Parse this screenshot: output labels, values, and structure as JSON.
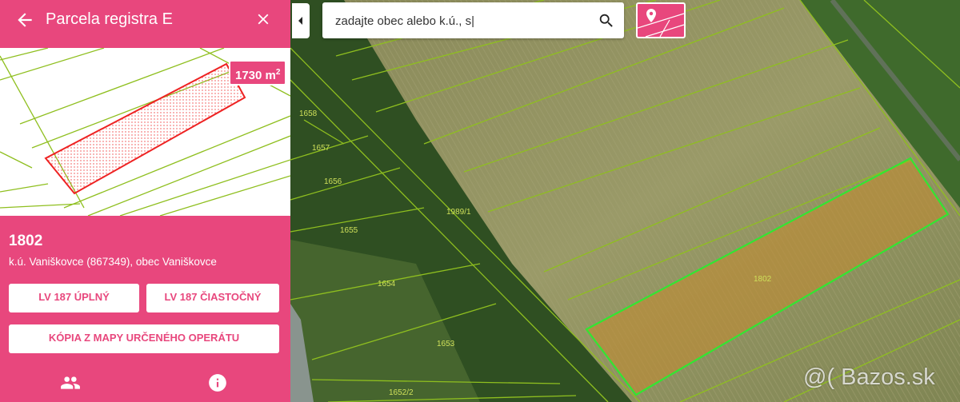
{
  "panel": {
    "title": "Parcela registra E",
    "area": "1730 m",
    "area_sup": "2",
    "parcel_number": "1802",
    "parcel_desc": "k.ú. Vaniškovce (867349), obec Vaniškovce",
    "buttons": {
      "lv_full": "LV 187 ÚPLNÝ",
      "lv_partial": "LV 187 ČIASTOČNÝ",
      "map_copy": "KÓPIA Z MAPY URČENÉHO OPERÁTU"
    },
    "icons": {
      "back": "arrow-back-icon",
      "close": "close-icon",
      "owners": "people-icon",
      "info": "info-icon"
    }
  },
  "search": {
    "value": "zadajte obec alebo k.ú., s|",
    "icon": "search-icon"
  },
  "map": {
    "labels": [
      "1658",
      "1657",
      "1656",
      "1655",
      "1654",
      "1653",
      "1652/2",
      "1989/1",
      "1802"
    ],
    "watermark": "@( Bazos.sk"
  },
  "colors": {
    "accent": "#e8477d",
    "parcel_line": "#8fbf1f",
    "selected": "#32e632"
  }
}
